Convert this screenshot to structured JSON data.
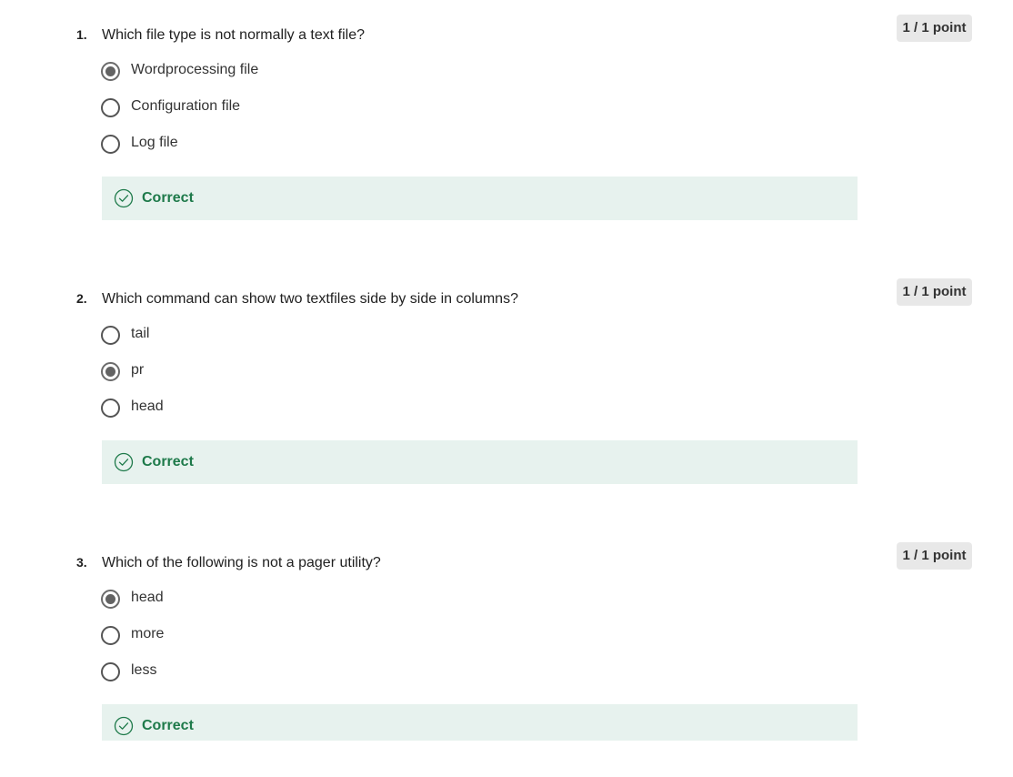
{
  "questions": [
    {
      "number": "1.",
      "text": "Which file type is not normally a text file?",
      "points": "1 / 1 point",
      "options": [
        {
          "label": "Wordprocessing file",
          "selected": true
        },
        {
          "label": "Configuration file",
          "selected": false
        },
        {
          "label": "Log file",
          "selected": false
        }
      ],
      "feedback": "Correct"
    },
    {
      "number": "2.",
      "text": "Which command can show two textfiles side by side in columns?",
      "points": "1 / 1 point",
      "options": [
        {
          "label": "tail",
          "selected": false
        },
        {
          "label": "pr",
          "selected": true
        },
        {
          "label": "head",
          "selected": false
        }
      ],
      "feedback": "Correct"
    },
    {
      "number": "3.",
      "text": "Which of the following is not a pager utility?",
      "points": "1 / 1 point",
      "options": [
        {
          "label": "head",
          "selected": true
        },
        {
          "label": "more",
          "selected": false
        },
        {
          "label": "less",
          "selected": false
        }
      ],
      "feedback": "Correct"
    }
  ],
  "icons": {
    "radio_selected": "radio-selected-icon",
    "radio_empty": "radio-empty-icon",
    "feedback": "check-circle-icon"
  },
  "colors": {
    "feedback_bg": "#e7f2ee",
    "feedback_text": "#1e7a4a",
    "points_bg": "#e8e8e8"
  }
}
